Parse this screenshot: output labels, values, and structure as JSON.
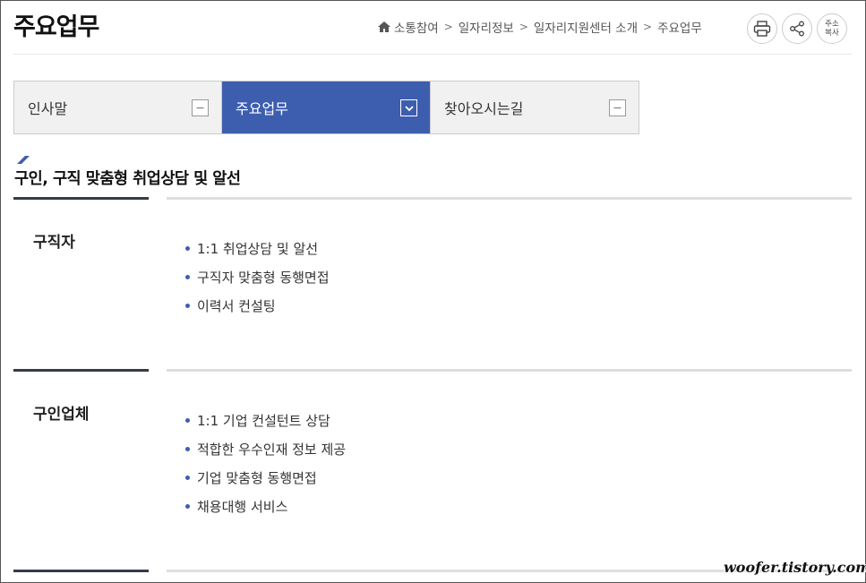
{
  "page_title": "주요업무",
  "breadcrumb": [
    "소통참여",
    "일자리정보",
    "일자리지원센터 소개",
    "주요업무"
  ],
  "tools": {
    "print_icon": "print-icon",
    "share_icon": "share-icon",
    "copy_url_label_1": "주소",
    "copy_url_label_2": "복사"
  },
  "tabs": [
    {
      "label": "인사말",
      "state": "collapsed"
    },
    {
      "label": "주요업무",
      "state": "active"
    },
    {
      "label": "찾아오시는길",
      "state": "collapsed"
    }
  ],
  "section_title": "구인, 구직 맞춤형 취업상담 및 알선",
  "rows": [
    {
      "label": "구직자",
      "items": [
        "1:1 취업상담 및 알선",
        "구직자 맞춤형 동행면접",
        "이력서 컨설팅"
      ]
    },
    {
      "label": "구인업체",
      "items": [
        "1:1 기업 컨설턴트 상담",
        "적합한 우수인재 정보 제공",
        "기업 맞춤형 동행면접",
        "채용대행 서비스"
      ]
    }
  ],
  "watermark": "woofer.tistory.com",
  "colors": {
    "accent": "#3d5eaf",
    "dark_line": "#333c4a"
  }
}
